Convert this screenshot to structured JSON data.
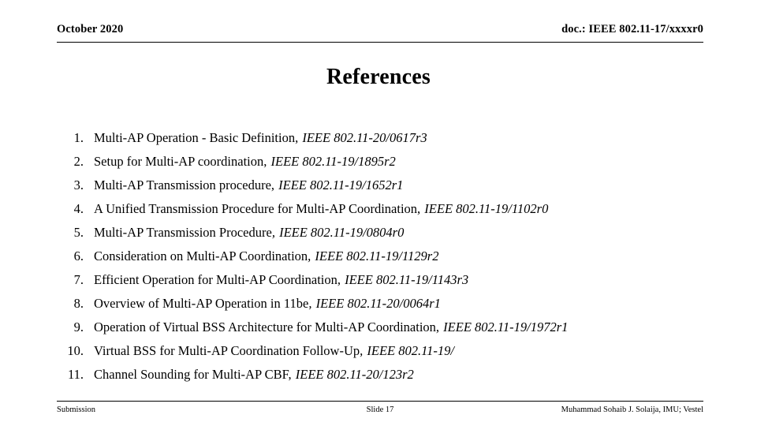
{
  "header": {
    "left": "October 2020",
    "right": "doc.: IEEE 802.11-17/xxxxr0"
  },
  "title": "References",
  "references": {
    "items": [
      {
        "number": "1.",
        "title": "Multi-AP Operation - Basic Definition",
        "separator": ", ",
        "doc": "IEEE 802.11-20/0617r3",
        "separator_italic": false
      },
      {
        "number": "2.",
        "title": "Setup for Multi-AP coordination",
        "separator": ", ",
        "doc": "IEEE 802.11-19/1895r2",
        "separator_italic": false
      },
      {
        "number": "3.",
        "title": "Multi-AP Transmission procedure",
        "separator": ", ",
        "doc": "IEEE 802.11-19/1652r1",
        "separator_italic": false
      },
      {
        "number": "4.",
        "title": "A Unified Transmission Procedure for Multi-AP Coordination",
        "separator": ", ",
        "doc": "IEEE 802.11-19/1102r0",
        "separator_italic": false
      },
      {
        "number": "5.",
        "title": "Multi-AP Transmission Procedure",
        "separator": ", ",
        "doc": "IEEE 802.11-19/0804r0",
        "separator_italic": true
      },
      {
        "number": "6.",
        "title": "Consideration on Multi-AP Coordination",
        "separator": ", ",
        "doc": "IEEE 802.11-19/1129r2",
        "separator_italic": true
      },
      {
        "number": "7.",
        "title": "Efficient Operation for Multi-AP Coordination",
        "separator": ", ",
        "doc": "IEEE 802.11-19/1143r3",
        "separator_italic": false
      },
      {
        "number": "8.",
        "title": "Overview of Multi-AP Operation in 11be",
        "separator": ", ",
        "doc": "IEEE 802.11-20/0064r1",
        "separator_italic": true
      },
      {
        "number": "9.",
        "title": "Operation of Virtual BSS Architecture for Multi-AP Coordination",
        "separator": ", ",
        "doc": "IEEE 802.11-19/1972r1",
        "separator_italic": false
      },
      {
        "number": "10.",
        "title": "Virtual BSS for Multi-AP Coordination Follow-Up",
        "separator": ", ",
        "doc": "IEEE 802.11-19/",
        "separator_italic": true
      },
      {
        "number": "11.",
        "title": "Channel Sounding for Multi-AP CBF",
        "separator": ", ",
        "doc": "IEEE 802.11-20/123r2",
        "separator_italic": false
      }
    ]
  },
  "footer": {
    "left": "Submission",
    "center": "Slide 17",
    "right": "Muhammad Sohaib J. Solaija, IMU; Vestel"
  },
  "colors": {
    "text": "#000000",
    "background": "#ffffff",
    "rule": "#000000"
  }
}
